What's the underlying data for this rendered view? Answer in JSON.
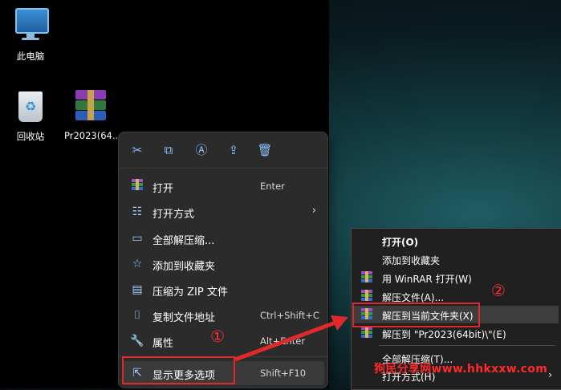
{
  "desktop": {
    "icons": [
      {
        "label": "此电脑",
        "icon": "computer-icon"
      },
      {
        "label": "回收站",
        "icon": "recycle-bin-icon"
      },
      {
        "label": "Pr2023(64...",
        "icon": "winrar-archive-icon"
      }
    ]
  },
  "context_menu": {
    "toolbar": [
      "cut-icon",
      "copy-icon",
      "rename-icon",
      "share-icon",
      "delete-icon"
    ],
    "items": [
      {
        "label": "打开",
        "shortcut": "Enter",
        "icon": "winrar-icon"
      },
      {
        "label": "打开方式",
        "shortcut": "",
        "icon": "open-with-icon",
        "submenu": true
      },
      {
        "label": "全部解压缩...",
        "shortcut": "",
        "icon": "extract-all-icon"
      },
      {
        "label": "添加到收藏夹",
        "shortcut": "",
        "icon": "star-icon"
      },
      {
        "label": "压缩为 ZIP 文件",
        "shortcut": "",
        "icon": "zip-icon"
      },
      {
        "label": "复制文件地址",
        "shortcut": "Ctrl+Shift+C",
        "icon": "copy-path-icon"
      },
      {
        "label": "属性",
        "shortcut": "Alt+Enter",
        "icon": "wrench-icon"
      },
      {
        "label": "显示更多选项",
        "shortcut": "Shift+F10",
        "icon": "more-options-icon"
      }
    ]
  },
  "classic_menu": {
    "items": [
      {
        "label": "打开(O)",
        "bold": true
      },
      {
        "label": "添加到收藏夹"
      },
      {
        "label": "用 WinRAR 打开(W)"
      },
      {
        "label": "解压文件(A)..."
      },
      {
        "label": "解压到当前文件夹(X)"
      },
      {
        "label": "解压到 \"Pr2023(64bit)\\\"(E)"
      },
      {
        "label": "全部解压缩(T)..."
      },
      {
        "label": "打开方式(H)"
      }
    ]
  },
  "annotations": {
    "step1": "①",
    "step2": "②",
    "watermark": "狗民分享网www.hhkxxw.com",
    "color": "#e02a2a"
  }
}
